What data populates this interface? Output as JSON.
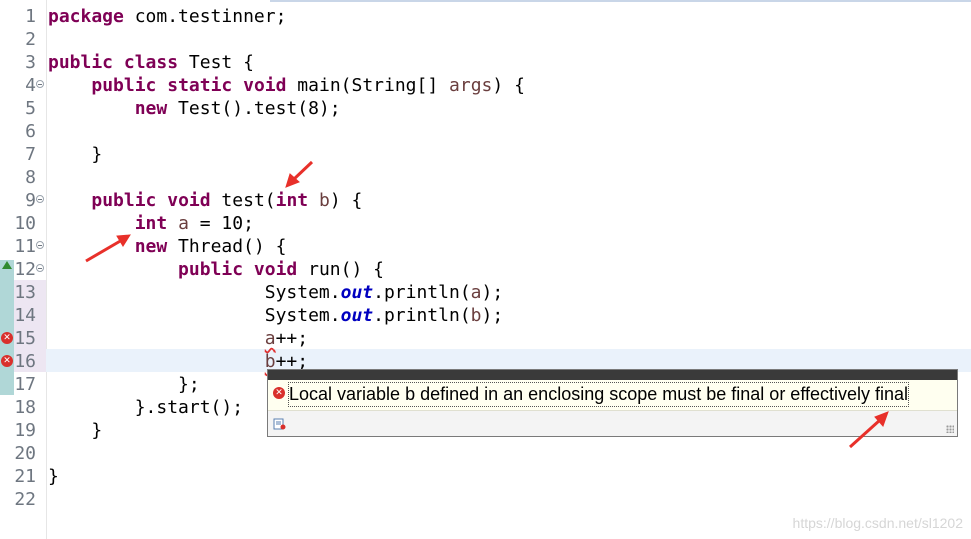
{
  "editor": {
    "lines": [
      {
        "num": "1",
        "code": [
          {
            "t": "package",
            "c": "kw"
          },
          {
            "t": " com.testinner;"
          }
        ]
      },
      {
        "num": "2",
        "code": []
      },
      {
        "num": "3",
        "code": [
          {
            "t": "public",
            "c": "kw"
          },
          {
            "t": " "
          },
          {
            "t": "class",
            "c": "kw"
          },
          {
            "t": " Test {"
          }
        ]
      },
      {
        "num": "4",
        "fold": true,
        "code": [
          {
            "t": "    "
          },
          {
            "t": "public",
            "c": "kw"
          },
          {
            "t": " "
          },
          {
            "t": "static",
            "c": "kw"
          },
          {
            "t": " "
          },
          {
            "t": "void",
            "c": "kw"
          },
          {
            "t": " main(String[] "
          },
          {
            "t": "args",
            "c": "var"
          },
          {
            "t": ") {"
          }
        ]
      },
      {
        "num": "5",
        "code": [
          {
            "t": "        "
          },
          {
            "t": "new",
            "c": "kw"
          },
          {
            "t": " Test().test(8);"
          }
        ]
      },
      {
        "num": "6",
        "code": []
      },
      {
        "num": "7",
        "code": [
          {
            "t": "    }"
          }
        ]
      },
      {
        "num": "8",
        "code": []
      },
      {
        "num": "9",
        "fold": true,
        "code": [
          {
            "t": "    "
          },
          {
            "t": "public",
            "c": "kw"
          },
          {
            "t": " "
          },
          {
            "t": "void",
            "c": "kw"
          },
          {
            "t": " test("
          },
          {
            "t": "int",
            "c": "kw"
          },
          {
            "t": " "
          },
          {
            "t": "b",
            "c": "var"
          },
          {
            "t": ") {"
          }
        ]
      },
      {
        "num": "10",
        "code": [
          {
            "t": "        "
          },
          {
            "t": "int",
            "c": "kw"
          },
          {
            "t": " "
          },
          {
            "t": "a",
            "c": "var"
          },
          {
            "t": " = 10;"
          }
        ]
      },
      {
        "num": "11",
        "fold": true,
        "code": [
          {
            "t": "        "
          },
          {
            "t": "new",
            "c": "kw"
          },
          {
            "t": " Thread() {"
          }
        ]
      },
      {
        "num": "12",
        "fold": true,
        "code": [
          {
            "t": "            "
          },
          {
            "t": "public",
            "c": "kw"
          },
          {
            "t": " "
          },
          {
            "t": "void",
            "c": "kw"
          },
          {
            "t": " run() {"
          }
        ]
      },
      {
        "num": "13",
        "code": [
          {
            "t": "                    System."
          },
          {
            "t": "out",
            "c": "fld"
          },
          {
            "t": ".println("
          },
          {
            "t": "a",
            "c": "var"
          },
          {
            "t": ");"
          }
        ]
      },
      {
        "num": "14",
        "code": [
          {
            "t": "                    System."
          },
          {
            "t": "out",
            "c": "fld"
          },
          {
            "t": ".println("
          },
          {
            "t": "b",
            "c": "var"
          },
          {
            "t": ");"
          }
        ]
      },
      {
        "num": "15",
        "error": true,
        "code": [
          {
            "t": "                    "
          },
          {
            "t": "a",
            "c": "var err-underline"
          },
          {
            "t": "++;"
          }
        ]
      },
      {
        "num": "16",
        "error": true,
        "code": [
          {
            "t": "                    "
          },
          {
            "t": "b",
            "c": "var err-underline"
          },
          {
            "t": "++;"
          }
        ]
      },
      {
        "num": "17",
        "code": [
          {
            "t": "            };"
          }
        ]
      },
      {
        "num": "18",
        "code": [
          {
            "t": "        }.start();"
          }
        ]
      },
      {
        "num": "19",
        "code": [
          {
            "t": "    }"
          }
        ]
      },
      {
        "num": "20",
        "code": []
      },
      {
        "num": "21",
        "code": [
          {
            "t": "}"
          }
        ]
      },
      {
        "num": "22",
        "code": []
      }
    ]
  },
  "tooltip": {
    "message": "Local variable b defined in an enclosing scope must be final or effectively final",
    "error_icon": "error-icon",
    "fix_icon": "quick-fix-icon"
  },
  "watermark": "https://blog.csdn.net/sl1202",
  "colors": {
    "keyword": "#7f0055",
    "local_var": "#6a3e3e",
    "static_field": "#0000c0",
    "annotation_arrow": "#e8302a",
    "error": "#d9302c"
  }
}
